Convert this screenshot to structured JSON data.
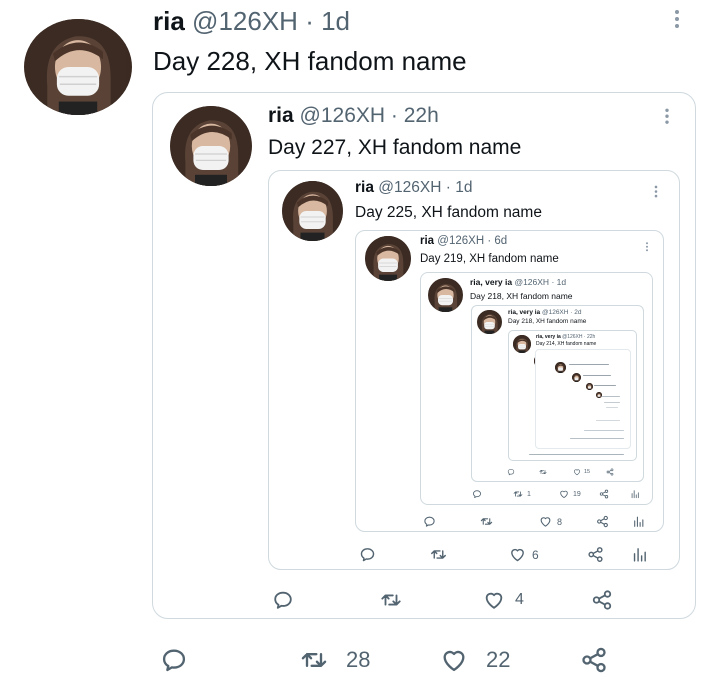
{
  "tweet": {
    "display_name": "ria",
    "handle": "@126XH",
    "time": "1d",
    "text": "Day 228, XH fandom name",
    "replies": "",
    "retweets": "28",
    "likes": "22"
  },
  "quote1": {
    "display_name": "ria",
    "handle": "@126XH",
    "time": "22h",
    "text": "Day 227, XH fandom name",
    "likes": "4"
  },
  "quote2": {
    "display_name": "ria",
    "handle": "@126XH",
    "time": "1d",
    "text": "Day 225, XH fandom name",
    "likes": "6"
  },
  "quote3": {
    "display_name": "ria",
    "handle": "@126XH",
    "time": "6d",
    "text": "Day 219, XH fandom name",
    "likes": "8"
  },
  "quote4": {
    "display_name": "ria, very ia",
    "handle": "@126XH",
    "time": "1d",
    "text": "Day 218, XH fandom name",
    "retweets": "1",
    "likes": "19"
  },
  "quote5": {
    "display_name": "ria, very ia",
    "handle": "@126XH",
    "time": "2d",
    "text": "Day 218, XH fandom name",
    "likes": "15"
  },
  "quote6": {
    "display_name": "ria, very ia",
    "handle": "@126XH",
    "time": "22h",
    "text": "Day 214, XH fandom name"
  },
  "colors": {
    "text": "#0f1419",
    "secondary": "#536471",
    "border": "#cfd9de"
  },
  "icons": [
    "reply-icon",
    "retweet-icon",
    "like-icon",
    "share-icon",
    "analytics-icon",
    "more-icon"
  ]
}
